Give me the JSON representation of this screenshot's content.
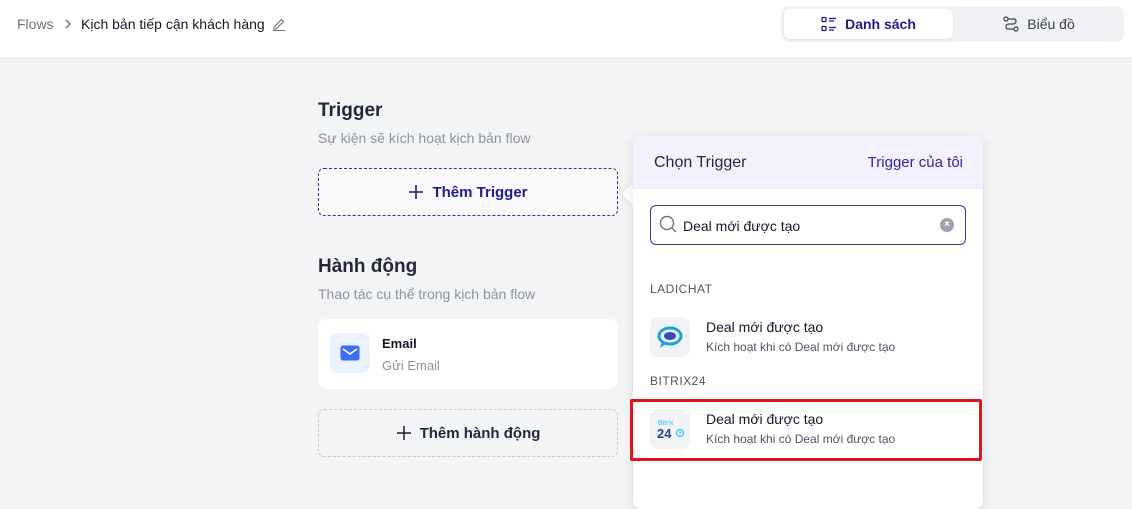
{
  "breadcrumb": {
    "root": "Flows",
    "title": "Kịch bản tiếp cận khách hàng"
  },
  "view_toggle": {
    "list_label": "Danh sách",
    "chart_label": "Biểu đồ",
    "accent": "#1e1b8f"
  },
  "trigger_section": {
    "title": "Trigger",
    "subtitle": "Sự kiện sẽ kích hoạt kịch bản flow",
    "add_label": "Thêm Trigger"
  },
  "action_section": {
    "title": "Hành động",
    "subtitle": "Thao tác cụ thể trong kịch bản flow",
    "email_card": {
      "title": "Email",
      "subtitle": "Gửi Email"
    },
    "add_label": "Thêm hành động"
  },
  "trigger_panel": {
    "title": "Chọn Trigger",
    "my_triggers_link": "Trigger của tôi",
    "search": {
      "value": "Deal mới được tạo",
      "placeholder": ""
    },
    "groups": [
      {
        "label": "LADICHAT",
        "items": [
          {
            "title": "Deal mới được tạo",
            "subtitle": "Kích hoạt khi có Deal mới được tạo",
            "icon": "ladichat-logo"
          }
        ]
      },
      {
        "label": "BITRIX24",
        "items": [
          {
            "title": "Deal mới được tạo",
            "subtitle": "Kích hoạt khi có Deal mới được tạo",
            "icon": "bitrix24-logo",
            "highlighted": true
          }
        ]
      }
    ],
    "highlight_color": "#e0131b"
  }
}
